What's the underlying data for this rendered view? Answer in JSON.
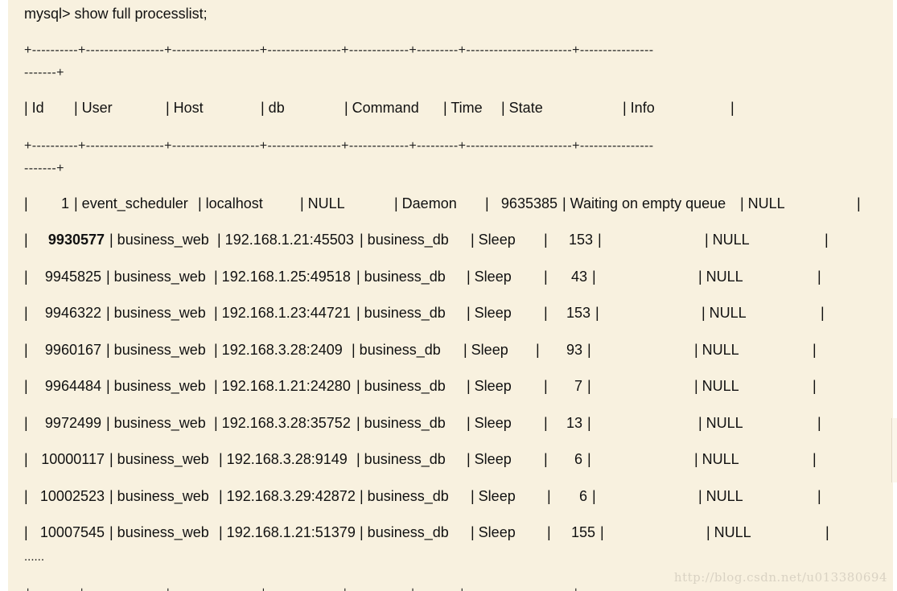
{
  "terminal": {
    "prompt_line": "mysql> show full processlist;",
    "border_line_1": "+----------+-----------------+-------------------+----------------+-------------+---------+-----------------------+----------------",
    "border_line_2": "-------+",
    "ellipsis": "......",
    "watermark": "http://blog.csdn.net/u013380694"
  },
  "header": [
    "| Id",
    "| User",
    "| Host",
    "| db",
    "| Command",
    "| Time",
    "| State",
    "| Info",
    "|"
  ],
  "rows": [
    {
      "id": "1",
      "user": "event_scheduler",
      "host": "localhost",
      "db": "NULL",
      "command": "Daemon",
      "time": "9635385",
      "state": "Waiting on empty queue",
      "info": "NULL"
    },
    {
      "id": "9930577",
      "user": "business_web",
      "host": "192.168.1.21:45503",
      "db": "business_db",
      "command": "Sleep",
      "time": "153",
      "state": "",
      "info": "NULL"
    },
    {
      "id": "9945825",
      "user": "business_web",
      "host": "192.168.1.25:49518",
      "db": "business_db",
      "command": "Sleep",
      "time": "43",
      "state": "",
      "info": "NULL"
    },
    {
      "id": "9946322",
      "user": "business_web",
      "host": "192.168.1.23:44721",
      "db": "business_db",
      "command": "Sleep",
      "time": "153",
      "state": "",
      "info": "NULL"
    },
    {
      "id": "9960167",
      "user": "business_web",
      "host": "192.168.3.28:2409",
      "db": "business_db",
      "command": "Sleep",
      "time": "93",
      "state": "",
      "info": "NULL"
    },
    {
      "id": "9964484",
      "user": "business_web",
      "host": "192.168.1.21:24280",
      "db": "business_db",
      "command": "Sleep",
      "time": "7",
      "state": "",
      "info": "NULL"
    },
    {
      "id": "9972499",
      "user": "business_web",
      "host": "192.168.3.28:35752",
      "db": "business_db",
      "command": "Sleep",
      "time": "13",
      "state": "",
      "info": "NULL"
    },
    {
      "id": "10000117",
      "user": "business_web",
      "host": "192.168.3.28:9149",
      "db": "business_db",
      "command": "Sleep",
      "time": "6",
      "state": "",
      "info": "NULL"
    },
    {
      "id": "10002523",
      "user": "business_web",
      "host": "192.168.3.29:42872",
      "db": "business_db",
      "command": "Sleep",
      "time": "6",
      "state": "",
      "info": "NULL"
    },
    {
      "id": "10007545",
      "user": "business_web",
      "host": "192.168.1.21:51379",
      "db": "business_db",
      "command": "Sleep",
      "time": "155",
      "state": "",
      "info": "NULL"
    }
  ]
}
